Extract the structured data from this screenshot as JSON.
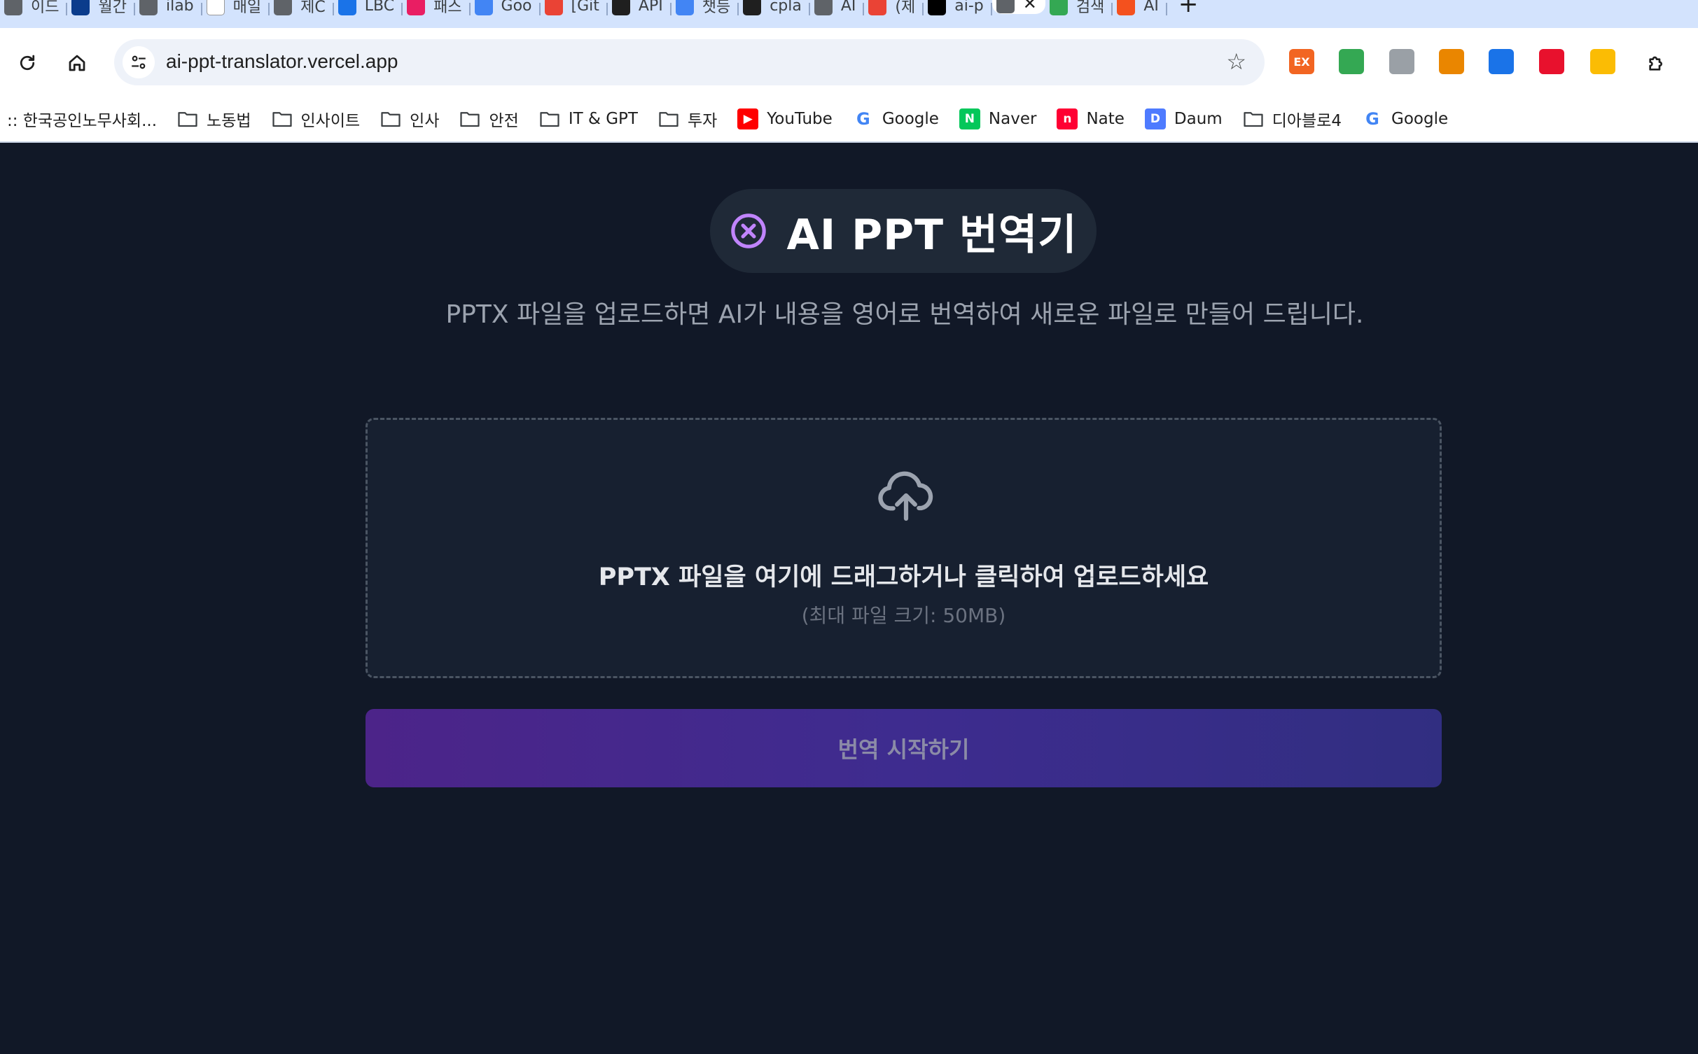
{
  "browser": {
    "tabs": [
      {
        "label": "이드",
        "icon": "page-icon",
        "color": "#5f6368"
      },
      {
        "label": "월간",
        "icon": "site-favicon-icon",
        "color": "#0b3c8c"
      },
      {
        "label": "ilab",
        "icon": "globe-icon",
        "color": "#5f6368"
      },
      {
        "label": "매일",
        "icon": "site-favicon-icon",
        "color": "#ffffff"
      },
      {
        "label": "제C",
        "icon": "site-favicon-icon",
        "color": "#5f6368"
      },
      {
        "label": "LBC",
        "icon": "site-favicon-icon",
        "color": "#1a73e8"
      },
      {
        "label": "패스",
        "icon": "site-favicon-icon",
        "color": "#e91e63"
      },
      {
        "label": "Goo",
        "icon": "google-icon",
        "color": "#4285f4"
      },
      {
        "label": "[Git",
        "icon": "gmail-icon",
        "color": "#ea4335"
      },
      {
        "label": "API",
        "icon": "site-favicon-icon",
        "color": "#1f1f1f"
      },
      {
        "label": "챗등",
        "icon": "google-icon",
        "color": "#4285f4"
      },
      {
        "label": "cpla",
        "icon": "github-icon",
        "color": "#1f1f1f"
      },
      {
        "label": "AI",
        "icon": "globe-icon",
        "color": "#5f6368"
      },
      {
        "label": "(제",
        "icon": "gmail-icon",
        "color": "#ea4335"
      },
      {
        "label": "ai-p",
        "icon": "vercel-icon",
        "color": "#000000"
      }
    ],
    "active_tab_icon": "globe-icon",
    "close_symbol": "✕",
    "tabs_after": [
      {
        "label": "검색",
        "icon": "drive-icon",
        "color": "#34a853"
      },
      {
        "label": "AI",
        "icon": "site-favicon-icon",
        "color": "#f4511e"
      }
    ],
    "new_tab_symbol": "+",
    "url": "ai-ppt-translator.vercel.app",
    "extensions": [
      {
        "name": "ex-extension-icon",
        "text": "EX",
        "color": "#f26522"
      },
      {
        "name": "green-extension-icon",
        "text": "",
        "color": "#34a853"
      },
      {
        "name": "globe-extension-icon",
        "text": "",
        "color": "#9aa0a6"
      },
      {
        "name": "cast-extension-icon",
        "text": "",
        "color": "#ea8600"
      },
      {
        "name": "file-extension-icon",
        "text": "",
        "color": "#1a73e8"
      },
      {
        "name": "adblock-extension-icon",
        "text": "",
        "color": "#e8112d"
      },
      {
        "name": "bulb-extension-icon",
        "text": "",
        "color": "#fbbc04"
      }
    ],
    "bookmarks": [
      {
        "label": ":: 한국공인노무사회...",
        "type": "text"
      },
      {
        "label": "노동법",
        "type": "folder"
      },
      {
        "label": "인사이트",
        "type": "folder"
      },
      {
        "label": "인사",
        "type": "folder"
      },
      {
        "label": "안전",
        "type": "folder"
      },
      {
        "label": "IT & GPT",
        "type": "folder"
      },
      {
        "label": "투자",
        "type": "folder"
      },
      {
        "label": "YouTube",
        "type": "youtube",
        "color": "#ff0000"
      },
      {
        "label": "Google",
        "type": "google",
        "color": "#4285f4"
      },
      {
        "label": "Naver",
        "type": "naver",
        "color": "#03c75a"
      },
      {
        "label": "Nate",
        "type": "nate",
        "color": "#ff0033"
      },
      {
        "label": "Daum",
        "type": "daum",
        "color": "#4e7bff"
      },
      {
        "label": "디아블로4",
        "type": "folder"
      },
      {
        "label": "Google",
        "type": "google",
        "color": "#4285f4"
      }
    ]
  },
  "app": {
    "title": "AI PPT 번역기",
    "logo_icon": "circle-x-icon",
    "accent_color": "#c084fc",
    "subtitle": "PPTX 파일을 업로드하면 AI가 내용을 영어로 번역하여 새로운 파일로 만들어 드립니다.",
    "dropzone": {
      "icon": "cloud-upload-icon",
      "main_text": "PPTX 파일을 여기에 드래그하거나 클릭하여 업로드하세요",
      "hint": "(최대 파일 크기: 50MB)"
    },
    "start_button": "번역 시작하기"
  }
}
